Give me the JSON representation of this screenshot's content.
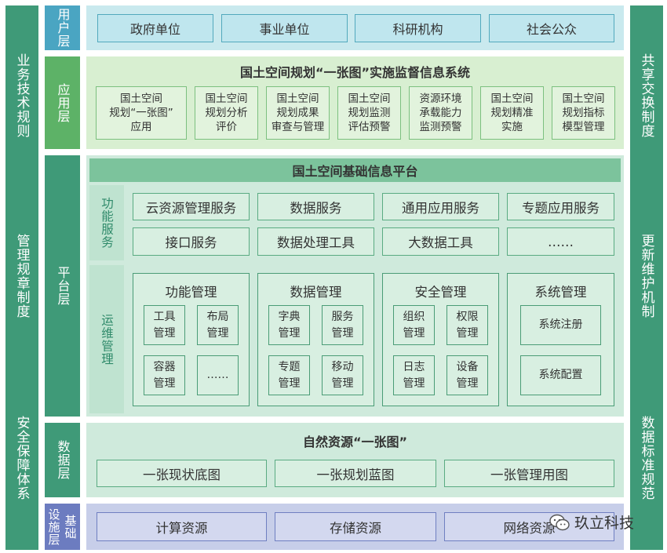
{
  "left_column": [
    {
      "label": "业务技术规则"
    },
    {
      "label": "管理规章制度"
    },
    {
      "label": "安全保障体系"
    }
  ],
  "right_column": [
    {
      "label": "共享交换制度"
    },
    {
      "label": "更新维护机制"
    },
    {
      "label": "数据标准规范"
    }
  ],
  "layers": {
    "user": "用户层",
    "app": "应用层",
    "platform": "平台层",
    "data": "数据层",
    "infra_a": "设施层",
    "infra_b": "基础"
  },
  "user_layer": {
    "items": [
      "政府单位",
      "事业单位",
      "科研机构",
      "社会公众"
    ]
  },
  "app_layer": {
    "title": "国土空间规划“一张图”实施监督信息系统",
    "items": [
      "国土空间\n规划“一张图”\n应用",
      "国土空间\n规划分析\n评价",
      "国土空间\n规划成果\n审查与管理",
      "国土空间\n规划监测\n评估预警",
      "资源环境\n承载能力\n监测预警",
      "国土空间\n规划精准\n实施",
      "国土空间\n规划指标\n模型管理"
    ]
  },
  "platform_layer": {
    "title": "国土空间基础信息平台",
    "func_label": "功能服务",
    "func_items": [
      "云资源管理服务",
      "数据服务",
      "通用应用服务",
      "专题应用服务",
      "接口服务",
      "数据处理工具",
      "大数据工具",
      "……"
    ],
    "ops_label": "运维管理",
    "groups": [
      {
        "title": "功能管理",
        "cells": [
          "工具\n管理",
          "布局\n管理",
          "容器\n管理",
          "……"
        ]
      },
      {
        "title": "数据管理",
        "cells": [
          "字典\n管理",
          "服务\n管理",
          "专题\n管理",
          "移动\n管理"
        ]
      },
      {
        "title": "安全管理",
        "cells": [
          "组织\n管理",
          "权限\n管理",
          "日志\n管理",
          "设备\n管理"
        ]
      },
      {
        "title": "系统管理",
        "cells": [
          "系统注册",
          "系统配置"
        ]
      }
    ]
  },
  "data_layer": {
    "title": "自然资源“一张图”",
    "items": [
      "一张现状底图",
      "一张规划蓝图",
      "一张管理用图"
    ]
  },
  "infra_layer": {
    "items": [
      "计算资源",
      "存储资源",
      "网络资源"
    ]
  },
  "watermark": "玖立科技",
  "colors": {
    "side": "#3f9a78",
    "user": "#4aa5c2",
    "app": "#5db267",
    "platform": "#3f9a78",
    "infra": "#6c7cc0"
  }
}
